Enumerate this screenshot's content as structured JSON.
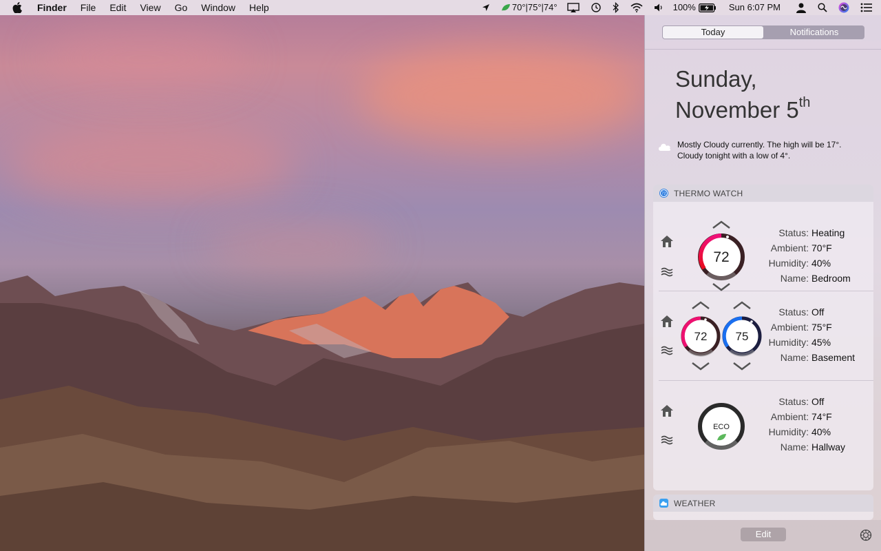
{
  "menubar": {
    "app_name": "Finder",
    "menus": [
      "File",
      "Edit",
      "View",
      "Go",
      "Window",
      "Help"
    ],
    "thermo_status": "70°|75°|74°",
    "battery": "100%",
    "clock": "Sun 6:07 PM"
  },
  "notification_center": {
    "tabs": [
      {
        "label": "Today",
        "active": true
      },
      {
        "label": "Notifications",
        "active": false
      }
    ],
    "date": {
      "line1": "Sunday,",
      "line2": "November 5",
      "suffix": "th"
    },
    "weather_summary": {
      "line1": "Mostly Cloudy currently. The high will be 17°.",
      "line2": "Cloudy tonight with a low of 4°."
    },
    "thermo_widget": {
      "title": "THERMO WATCH",
      "labels": {
        "status": "Status:",
        "ambient": "Ambient:",
        "humidity": "Humidity:",
        "name": "Name:"
      },
      "thermostats": [
        {
          "status": "Heating",
          "ambient": "70°F",
          "humidity": "40%",
          "name": "Bedroom",
          "mode": "heat",
          "setpoints": [
            "72"
          ]
        },
        {
          "status": "Off",
          "ambient": "75°F",
          "humidity": "45%",
          "name": "Basement",
          "mode": "heat-cool",
          "setpoints": [
            "72",
            "75"
          ]
        },
        {
          "status": "Off",
          "ambient": "74°F",
          "humidity": "40%",
          "name": "Hallway",
          "mode": "eco",
          "setpoints": [
            "ECO"
          ]
        }
      ]
    },
    "weather_widget": {
      "title": "WEATHER"
    },
    "edit_label": "Edit"
  },
  "colors": {
    "heat": "#e8106a",
    "cool": "#1a6ff0",
    "eco_leaf": "#5cb85c"
  }
}
